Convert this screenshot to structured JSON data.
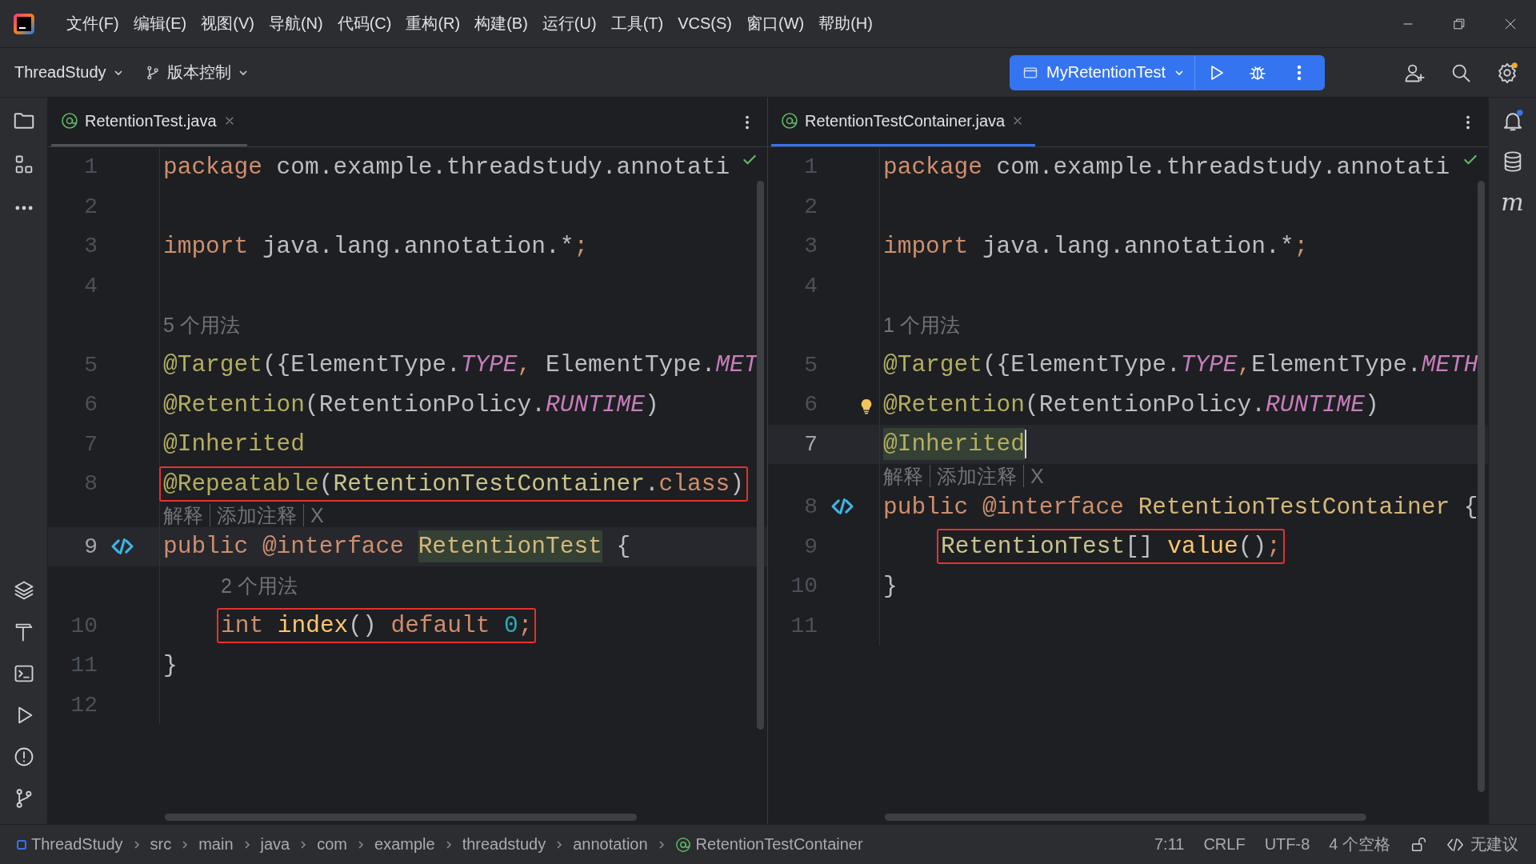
{
  "menu": [
    {
      "label": "文件(F)"
    },
    {
      "label": "编辑(E)"
    },
    {
      "label": "视图(V)"
    },
    {
      "label": "导航(N)"
    },
    {
      "label": "代码(C)"
    },
    {
      "label": "重构(R)"
    },
    {
      "label": "构建(B)"
    },
    {
      "label": "运行(U)"
    },
    {
      "label": "工具(T)"
    },
    {
      "label": "VCS(S)"
    },
    {
      "label": "窗口(W)"
    },
    {
      "label": "帮助(H)"
    }
  ],
  "toolbar": {
    "project": "ThreadStudy",
    "vcs": "版本控制",
    "run_config": "MyRetentionTest"
  },
  "editors": [
    {
      "tab": {
        "label": "RetentionTest.java",
        "selected": false
      },
      "lines": [
        {
          "kind": "code",
          "number": "1",
          "check": true,
          "tokens": [
            {
              "t": "package",
              "kind": "kw"
            },
            {
              "t": " com.example.threadstudy.annotati",
              "kind": "plain"
            }
          ]
        },
        {
          "kind": "code",
          "number": "2"
        },
        {
          "kind": "code",
          "number": "3",
          "tokens": [
            {
              "t": "import",
              "kind": "kw"
            },
            {
              "t": " java.lang.annotation.*",
              "kind": "plain"
            },
            {
              "t": ";",
              "kind": "kw"
            }
          ]
        },
        {
          "kind": "code",
          "number": "4"
        },
        {
          "kind": "hint",
          "text": "5 个用法"
        },
        {
          "kind": "code",
          "number": "5",
          "tokens": [
            {
              "t": "@Target",
              "kind": "ann"
            },
            {
              "t": "({ElementType.",
              "kind": "plain"
            },
            {
              "t": "TYPE",
              "kind": "const"
            },
            {
              "t": ",",
              "kind": "kw"
            },
            {
              "t": " ElementType.",
              "kind": "plain"
            },
            {
              "t": "MET",
              "kind": "const"
            }
          ]
        },
        {
          "kind": "code",
          "number": "6",
          "tokens": [
            {
              "t": "@Retention",
              "kind": "ann"
            },
            {
              "t": "(RetentionPolicy.",
              "kind": "plain"
            },
            {
              "t": "RUNTIME",
              "kind": "const"
            },
            {
              "t": ")",
              "kind": "plain"
            }
          ]
        },
        {
          "kind": "code",
          "number": "7",
          "tokens": [
            {
              "t": "@Inherited",
              "kind": "ann"
            }
          ]
        },
        {
          "kind": "code",
          "number": "8",
          "boxed": true,
          "tokens": [
            {
              "t": "@Repeatable",
              "kind": "ann"
            },
            {
              "t": "(",
              "kind": "plain"
            },
            {
              "t": "RetentionTestContainer",
              "kind": "type"
            },
            {
              "t": ".",
              "kind": "plain"
            },
            {
              "t": "class",
              "kind": "kw"
            },
            {
              "t": ")",
              "kind": "plain"
            }
          ]
        },
        {
          "kind": "codevision",
          "items": [
            "解释",
            "添加注释",
            "X"
          ]
        },
        {
          "kind": "code",
          "number": "9",
          "current": true,
          "implemented": true,
          "tokens": [
            {
              "t": "public @interface ",
              "kind": "kw"
            },
            {
              "t": "RetentionTest",
              "kind": "decl",
              "highlight": true
            },
            {
              "t": " {",
              "kind": "plain"
            }
          ]
        },
        {
          "kind": "member_hint",
          "text": "2 个用法"
        },
        {
          "kind": "code",
          "number": "10",
          "indented": true,
          "boxed": true,
          "tokens": [
            {
              "t": "int ",
              "kind": "kw"
            },
            {
              "t": "index",
              "kind": "method"
            },
            {
              "t": "() ",
              "kind": "plain"
            },
            {
              "t": "default ",
              "kind": "kw"
            },
            {
              "t": "0",
              "kind": "num"
            },
            {
              "t": ";",
              "kind": "kw"
            }
          ]
        },
        {
          "kind": "code",
          "number": "11",
          "tokens": [
            {
              "t": "}",
              "kind": "plain"
            }
          ]
        },
        {
          "kind": "code",
          "number": "12"
        }
      ]
    },
    {
      "tab": {
        "label": "RetentionTestContainer.java",
        "selected": true
      },
      "lines": [
        {
          "kind": "code",
          "number": "1",
          "check": true,
          "tokens": [
            {
              "t": "package",
              "kind": "kw"
            },
            {
              "t": " com.example.threadstudy.annotati",
              "kind": "plain"
            }
          ]
        },
        {
          "kind": "code",
          "number": "2"
        },
        {
          "kind": "code",
          "number": "3",
          "tokens": [
            {
              "t": "import",
              "kind": "kw"
            },
            {
              "t": " java.lang.annotation.*",
              "kind": "plain"
            },
            {
              "t": ";",
              "kind": "kw"
            }
          ]
        },
        {
          "kind": "code",
          "number": "4"
        },
        {
          "kind": "hint",
          "text": "1 个用法"
        },
        {
          "kind": "code",
          "number": "5",
          "tokens": [
            {
              "t": "@Target",
              "kind": "ann"
            },
            {
              "t": "({ElementType.",
              "kind": "plain"
            },
            {
              "t": "TYPE",
              "kind": "const"
            },
            {
              "t": ",",
              "kind": "kw"
            },
            {
              "t": "ElementType.",
              "kind": "plain"
            },
            {
              "t": "METH",
              "kind": "const"
            }
          ]
        },
        {
          "kind": "code",
          "number": "6",
          "bulb": true,
          "tokens": [
            {
              "t": "@Retention",
              "kind": "ann"
            },
            {
              "t": "(RetentionPolicy.",
              "kind": "plain"
            },
            {
              "t": "RUNTIME",
              "kind": "const"
            },
            {
              "t": ")",
              "kind": "plain"
            }
          ]
        },
        {
          "kind": "code",
          "number": "7",
          "current": true,
          "caret": true,
          "tokens": [
            {
              "t": "@Inherited",
              "kind": "ann",
              "highlight": true
            }
          ]
        },
        {
          "kind": "codevision",
          "items": [
            "解释",
            "添加注释",
            "X"
          ]
        },
        {
          "kind": "code",
          "number": "8",
          "implemented": true,
          "tokens": [
            {
              "t": "public @interface ",
              "kind": "kw"
            },
            {
              "t": "RetentionTestContainer",
              "kind": "decl"
            },
            {
              "t": " {",
              "kind": "plain"
            }
          ]
        },
        {
          "kind": "code",
          "number": "9",
          "indented": true,
          "boxed": true,
          "tokens": [
            {
              "t": "RetentionTest",
              "kind": "type"
            },
            {
              "t": "[] ",
              "kind": "plain"
            },
            {
              "t": "value",
              "kind": "method"
            },
            {
              "t": "()",
              "kind": "plain"
            },
            {
              "t": ";",
              "kind": "kw"
            }
          ]
        },
        {
          "kind": "code",
          "number": "10",
          "tokens": [
            {
              "t": "}",
              "kind": "plain"
            }
          ]
        },
        {
          "kind": "code",
          "number": "11"
        }
      ]
    }
  ],
  "right_strip": {
    "maven_label": "m"
  },
  "status_bar": {
    "breadcrumbs": [
      {
        "label": "ThreadStudy",
        "kind": "module"
      },
      {
        "label": "src",
        "kind": "dir"
      },
      {
        "label": "main",
        "kind": "dir"
      },
      {
        "label": "java",
        "kind": "dir"
      },
      {
        "label": "com",
        "kind": "dir"
      },
      {
        "label": "example",
        "kind": "dir"
      },
      {
        "label": "threadstudy",
        "kind": "dir"
      },
      {
        "label": "annotation",
        "kind": "dir"
      },
      {
        "label": "RetentionTestContainer",
        "kind": "annotation"
      }
    ],
    "position": "7:11",
    "line_ending": "CRLF",
    "encoding": "UTF-8",
    "indent": "4 个空格",
    "inspection": "无建议"
  }
}
